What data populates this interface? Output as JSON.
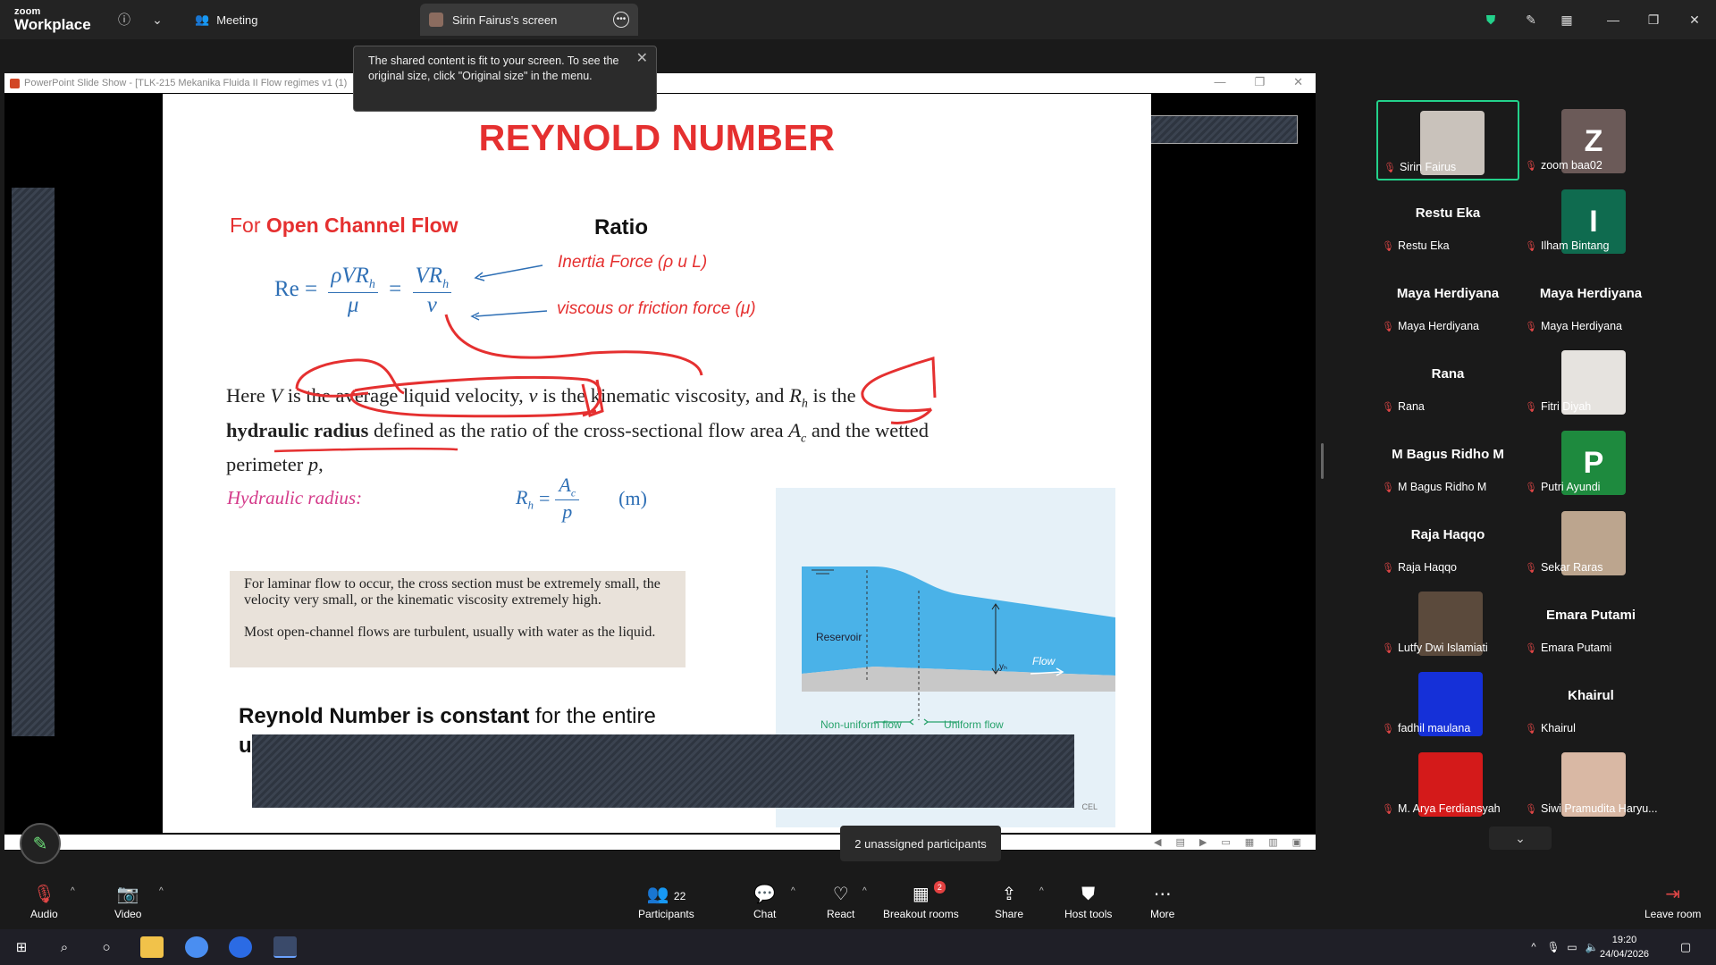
{
  "app": {
    "brand_line1": "zoom",
    "brand_line2": "Workplace",
    "meeting_tab": "Meeting",
    "screen_tab": "Sirin Fairus's screen"
  },
  "tooltip": {
    "text": "The shared content is fit to your screen. To see the original size, click \"Original size\" in the menu."
  },
  "ppt": {
    "window_title": "PowerPoint Slide Show - [TLK-215 Mekanika Fluida II Flow regimes v1 (1)",
    "slide": {
      "title": "REYNOLD NUMBER",
      "for_prefix": "For ",
      "for_bold": "Open Channel Flow",
      "ratio": "Ratio",
      "eq_re": "Re =",
      "eq_num1": "ρVR",
      "eq_sub_h": "h",
      "eq_den1": "μ",
      "eq_eq": "=",
      "eq_num2": "VR",
      "eq_den2": "ν",
      "inertia": "Inertia Force (ρ u L)",
      "viscous": "viscous or friction force (μ)",
      "para_1": "Here ",
      "para_V": "V",
      "para_2": " is the average liquid velocity, ",
      "para_nu": "ν",
      "para_3": " is the kinematic viscosity, and ",
      "para_R": "R",
      "para_4": " is the ",
      "para_bold": "hydraulic radius",
      "para_5": " defined as the ratio of the cross-sectional flow area ",
      "para_A": "A",
      "para_c": "c",
      "para_6": " and the wetted perimeter ",
      "para_p": "p",
      "para_7": ",",
      "hr_label": "Hydraulic radius:",
      "hr_R": "R",
      "hr_eq": "=",
      "hr_num": "A",
      "hr_den": "p",
      "hr_unit": "(m)",
      "note1": "For laminar flow to occur, the cross section must be extremely small, the velocity very small, or the kinematic viscosity extremely high.",
      "note2": "Most open-channel flows are turbulent, usually with water as the liquid.",
      "fig_reservoir": "Reservoir",
      "fig_flow": "Flow",
      "fig_yh": "yₕ",
      "fig_nonuniform": "Non-uniform flow",
      "fig_uniform": "Uniform flow",
      "fig_credit": "CEL",
      "bottom_bold": "Reynold Number is constant",
      "bottom_rest": " for the entire",
      "bottom_line2": "u"
    }
  },
  "unassigned": "2 unassigned participants",
  "participants": [
    {
      "name": "Sirin Fairus",
      "type": "photo",
      "color": "#c9c2bb",
      "active": true
    },
    {
      "name": "zoom baa02",
      "type": "letter",
      "letter": "Z",
      "color": "#6b5a58"
    },
    {
      "name": "Restu Eka",
      "type": "name"
    },
    {
      "name": "Ilham Bintang",
      "type": "letter",
      "letter": "I",
      "color": "#0f6b4f"
    },
    {
      "name": "Maya Herdiyana",
      "type": "name"
    },
    {
      "name": "Maya Herdiyana",
      "type": "name"
    },
    {
      "name": "Rana",
      "type": "name"
    },
    {
      "name": "Fitri Diyah",
      "type": "photo",
      "color": "#e6e3df"
    },
    {
      "name": "M Bagus Ridho M",
      "type": "name"
    },
    {
      "name": "Putri Ayundi",
      "type": "letter",
      "letter": "P",
      "color": "#1e8a3e"
    },
    {
      "name": "Raja Haqqo",
      "type": "name"
    },
    {
      "name": "Sekar Raras",
      "type": "photo",
      "color": "#bca58e"
    },
    {
      "name": "Lutfy Dwi Islamiati",
      "type": "photo",
      "color": "#5b4a3c"
    },
    {
      "name": "Emara Putami",
      "type": "name"
    },
    {
      "name": "fadhil maulana",
      "type": "photo",
      "color": "#1530d8"
    },
    {
      "name": "Khairul",
      "type": "name"
    },
    {
      "name": "M. Arya Ferdiansyah",
      "type": "photo",
      "color": "#d41a1a"
    },
    {
      "name": "Siwi Pramudita Haryu...",
      "type": "photo",
      "color": "#d9b8a4"
    }
  ],
  "toolbar": {
    "audio": "Audio",
    "video": "Video",
    "participants": "Participants",
    "participants_count": "22",
    "chat": "Chat",
    "react": "React",
    "breakout": "Breakout rooms",
    "breakout_badge": "2",
    "share": "Share",
    "host_tools": "Host tools",
    "more": "More",
    "leave": "Leave room"
  },
  "taskbar": {
    "time": "19:20",
    "date": "24/04/2026"
  },
  "colors": {
    "accent_green": "#23d18b",
    "slide_red": "#e53030",
    "formula_blue": "#2e6fb5"
  }
}
